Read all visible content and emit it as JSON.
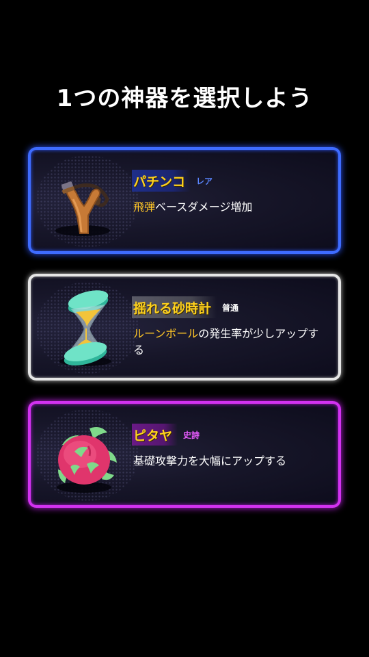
{
  "title": "1つの神器を選択しよう",
  "cards": [
    {
      "icon": "slingshot-icon",
      "name": "パチンコ",
      "rarity": "レア",
      "desc_highlight": "飛弾",
      "desc_rest": "ベースダメージ増加",
      "border_color": "#3e6cff"
    },
    {
      "icon": "hourglass-icon",
      "name": "揺れる砂時計",
      "rarity": "普通",
      "desc_highlight": "ルーンボール",
      "desc_rest": "の発生率が少しアップする",
      "border_color": "#e6e6e6"
    },
    {
      "icon": "dragon-fruit-icon",
      "name": "ピタヤ",
      "rarity": "史詩",
      "desc_highlight": "",
      "desc_rest": "基礎攻撃力を大幅にアップする",
      "border_color": "#d232f0"
    }
  ],
  "colors": {
    "highlight": "#ffc627",
    "name": "#ffd21e",
    "background": "#000000"
  }
}
